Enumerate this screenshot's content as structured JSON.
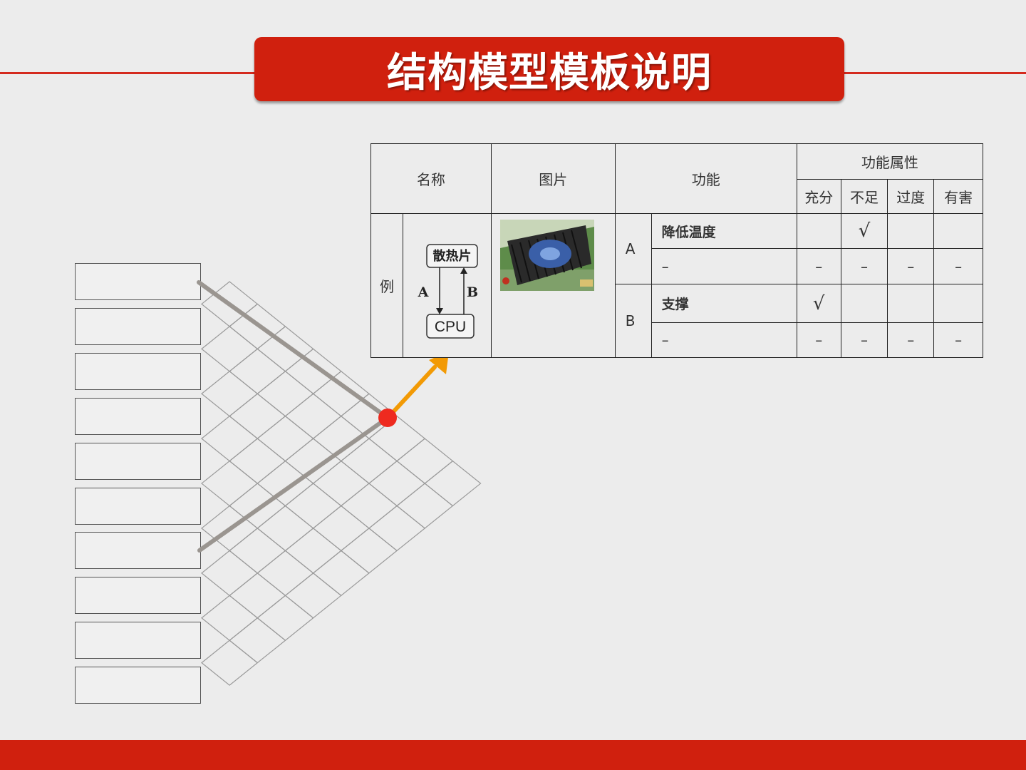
{
  "title": "结构模型模板说明",
  "table": {
    "headers": {
      "name": "名称",
      "image": "图片",
      "function": "功能",
      "attributes": "功能属性",
      "attr_cols": [
        "充分",
        "不足",
        "过度",
        "有害"
      ]
    },
    "example_label": "例",
    "diagram": {
      "top_box": "散热片",
      "bottom_box": "CPU",
      "arrow_a": "A",
      "arrow_b": "B"
    },
    "rows": [
      {
        "group": "A",
        "function": "降低温度",
        "marks": [
          "",
          "√",
          "",
          ""
        ]
      },
      {
        "group": "",
        "function": "–",
        "marks": [
          "–",
          "–",
          "–",
          "–"
        ]
      },
      {
        "group": "B",
        "function": "支撑",
        "marks": [
          "√",
          "",
          "",
          ""
        ]
      },
      {
        "group": "",
        "function": "–",
        "marks": [
          "–",
          "–",
          "–",
          "–"
        ]
      }
    ]
  },
  "colors": {
    "accent_red": "#d0200e",
    "arrow_orange": "#f29a05",
    "node_red": "#ee2a1f",
    "connector_gray": "#9a9590"
  }
}
